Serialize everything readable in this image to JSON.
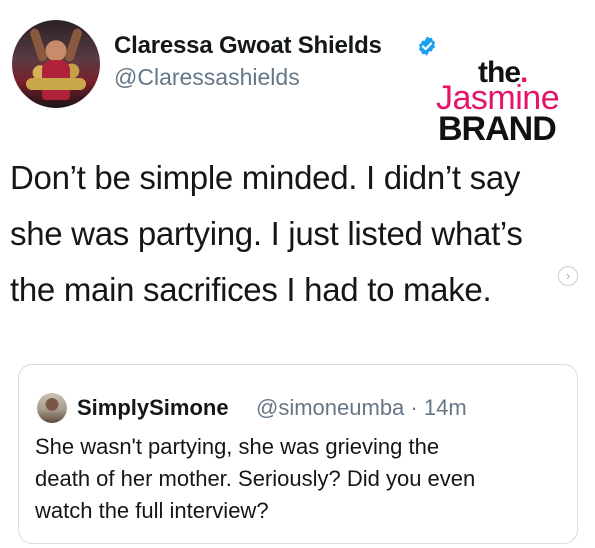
{
  "tweet": {
    "author_name": "Claressa Gwoat Shields",
    "author_handle": "@Claressashields",
    "verified": true,
    "text_line1": "Don’t be simple minded. I didn’t say",
    "text_line2": "she was partying. I just listed what’s",
    "text_line3": "the main sacrifices I had to make.",
    "more_icon": "chevron-right-icon"
  },
  "quoted_tweet": {
    "author_name": "SimplySimone",
    "author_handle": "@simoneumba",
    "separator": "·",
    "time": "14m",
    "text_line1": "She wasn't partying, she was grieving the",
    "text_line2": "death of her mother. Seriously? Did you even",
    "text_line3": "watch the full interview?"
  },
  "watermark": {
    "line1": "the",
    "line1_dot": ".",
    "line2": "Jasmine",
    "line3": "BRAND"
  },
  "colors": {
    "verified_blue": "#1da1f2",
    "handle_gray": "#657786",
    "brand_pink": "#e4146b"
  }
}
